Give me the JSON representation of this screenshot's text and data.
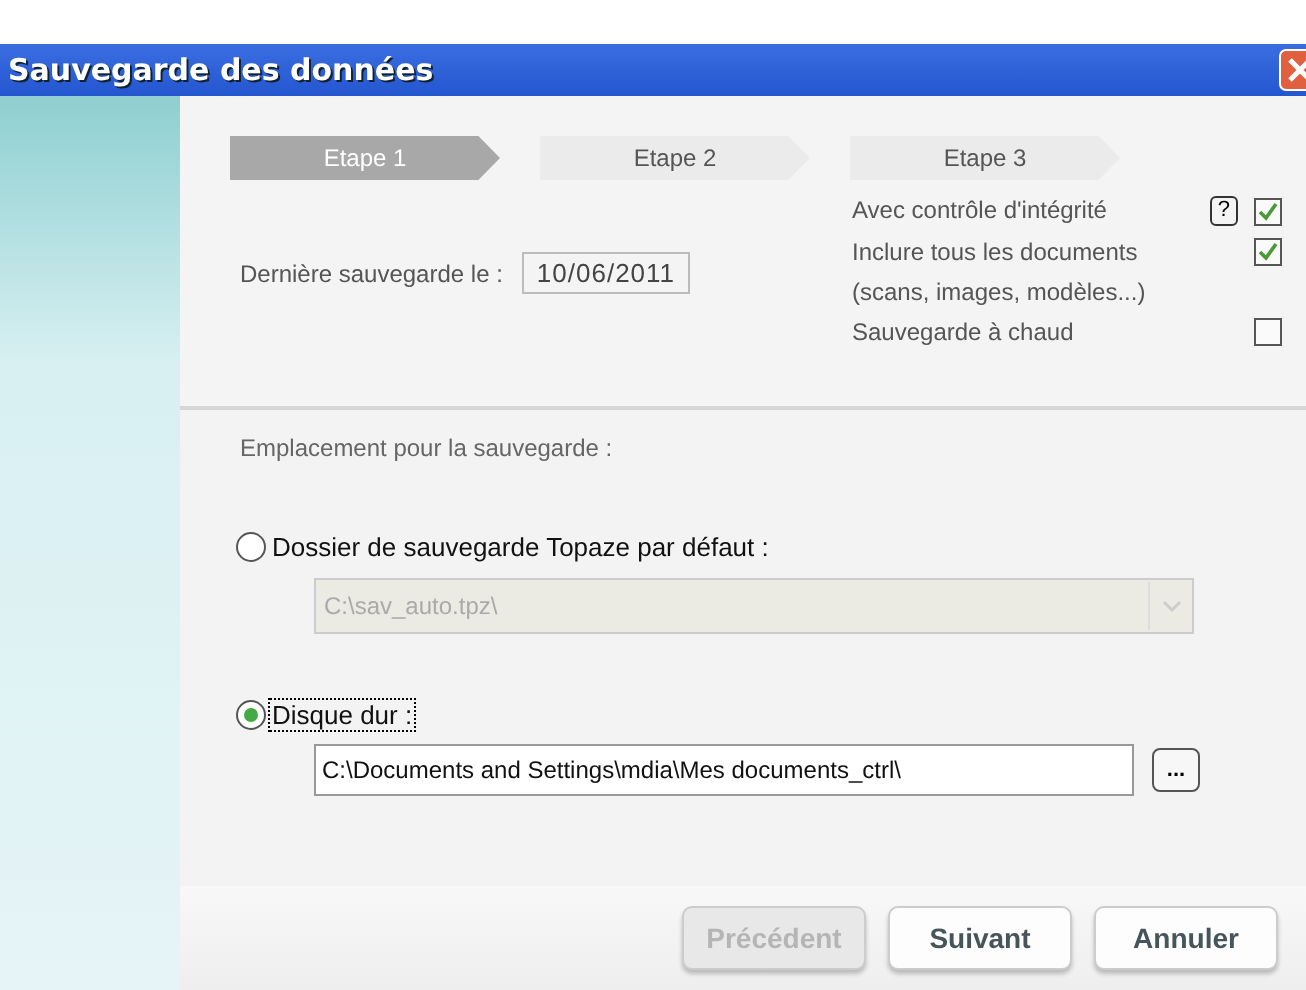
{
  "window": {
    "title": "Sauvegarde des données"
  },
  "steps": [
    {
      "label": "Etape 1",
      "selected": true
    },
    {
      "label": "Etape 2",
      "selected": false
    },
    {
      "label": "Etape 3",
      "selected": false
    }
  ],
  "last_backup": {
    "label": "Dernière sauvegarde le :",
    "value": "10/06/2011"
  },
  "options": [
    {
      "label": "Avec contrôle d'intégrité",
      "help": "?",
      "checked": true
    },
    {
      "label": "Inclure tous les documents",
      "sublabel": "(scans, images, modèles...)",
      "checked": true
    },
    {
      "label": "Sauvegarde à chaud",
      "checked": false
    }
  ],
  "location": {
    "heading": "Emplacement pour la sauvegarde  :",
    "choices": [
      {
        "label": "Dossier de sauvegarde Topaze par défaut :",
        "selected": false,
        "kind": "combo",
        "value": "C:\\sav_auto.tpz\\",
        "disabled": true
      },
      {
        "label": "Disque dur :",
        "selected": true,
        "kind": "path",
        "value": "C:\\Documents and Settings\\mdia\\Mes documents_ctrl\\",
        "browse": "..."
      }
    ]
  },
  "buttons": [
    {
      "label": "Précédent",
      "disabled": true
    },
    {
      "label": "Suivant",
      "disabled": false
    },
    {
      "label": "Annuler",
      "disabled": false
    }
  ]
}
